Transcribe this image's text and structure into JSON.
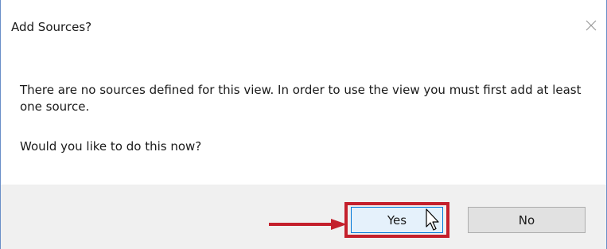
{
  "dialog": {
    "title": "Add Sources?",
    "close_icon": "close-icon",
    "message": "There are no sources defined for this view. In order to use the view you must first add at least one source.",
    "question": "Would you like to do this now?"
  },
  "buttons": {
    "yes_label": "Yes",
    "no_label": "No"
  },
  "annotation": {
    "arrow_icon": "right-arrow-icon",
    "highlight_color": "#c4202c"
  },
  "colors": {
    "primary_button_bg": "#e5f1fb",
    "primary_button_border": "#0078d7",
    "footer_bg": "#f0f0f0"
  }
}
